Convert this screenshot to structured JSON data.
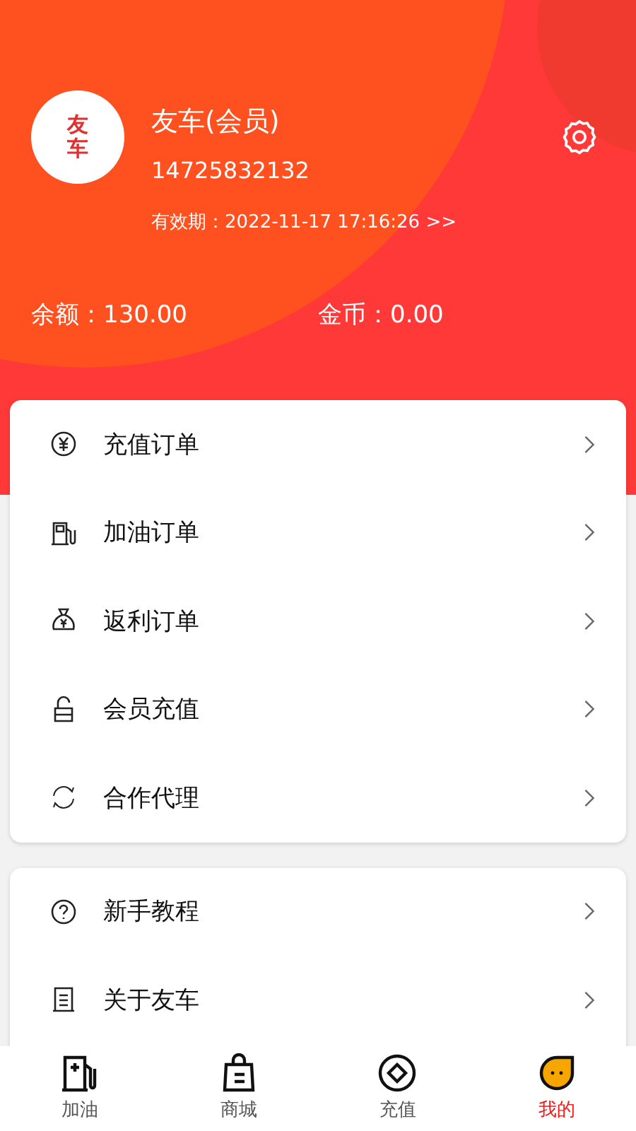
{
  "profile": {
    "logo_text": "友车",
    "name": "友车(会员)",
    "phone": "14725832132",
    "validity": "有效期：2022-11-17 17:16:26 >>"
  },
  "balance": {
    "label": "余额：130.00"
  },
  "coins": {
    "label": "金币：0.00"
  },
  "menu_groups": [
    {
      "items": [
        {
          "kind": "yuan",
          "label": "充值订单"
        },
        {
          "kind": "pump",
          "label": "加油订单"
        },
        {
          "kind": "bag",
          "label": "返利订单"
        },
        {
          "kind": "lock",
          "label": "会员充值"
        },
        {
          "kind": "cycle",
          "label": "合作代理"
        }
      ]
    },
    {
      "items": [
        {
          "kind": "help",
          "label": "新手教程"
        },
        {
          "kind": "doc",
          "label": "关于友车"
        }
      ]
    }
  ],
  "tabs": [
    {
      "kind": "fuel",
      "label": "加油",
      "selected": false
    },
    {
      "kind": "shop",
      "label": "商城",
      "selected": false
    },
    {
      "kind": "topup",
      "label": "充值",
      "selected": false
    },
    {
      "kind": "me",
      "label": "我的",
      "selected": true
    }
  ]
}
